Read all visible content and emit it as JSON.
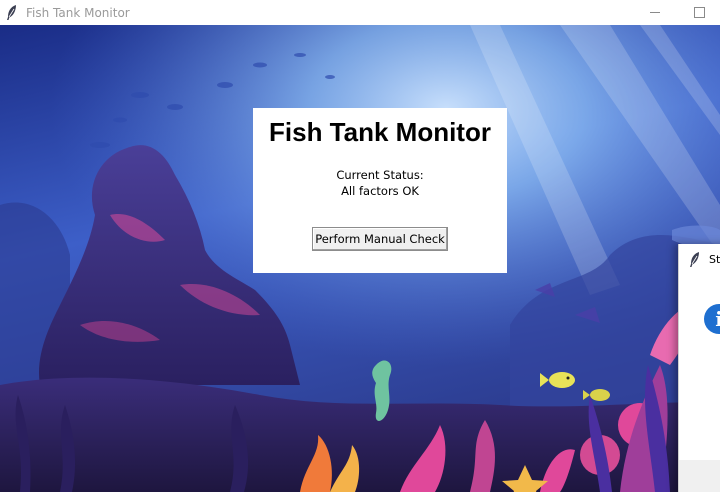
{
  "window": {
    "title": "Fish Tank Monitor",
    "icon": "feather-icon"
  },
  "panel": {
    "heading": "Fish Tank Monitor",
    "status_label": "Current Status:",
    "status_value": "All factors OK",
    "check_button_label": "Perform Manual Check"
  },
  "dialog": {
    "title_fragment": "St",
    "icon": "info-icon",
    "icon_glyph": "i"
  },
  "colors": {
    "sky_top": "#1b2a78",
    "sky_light": "#7fb6f2",
    "rock": "#3b2f7a",
    "coral_pink": "#e0489a",
    "coral_orange": "#f07a3a",
    "info_blue": "#1e6fd0"
  }
}
